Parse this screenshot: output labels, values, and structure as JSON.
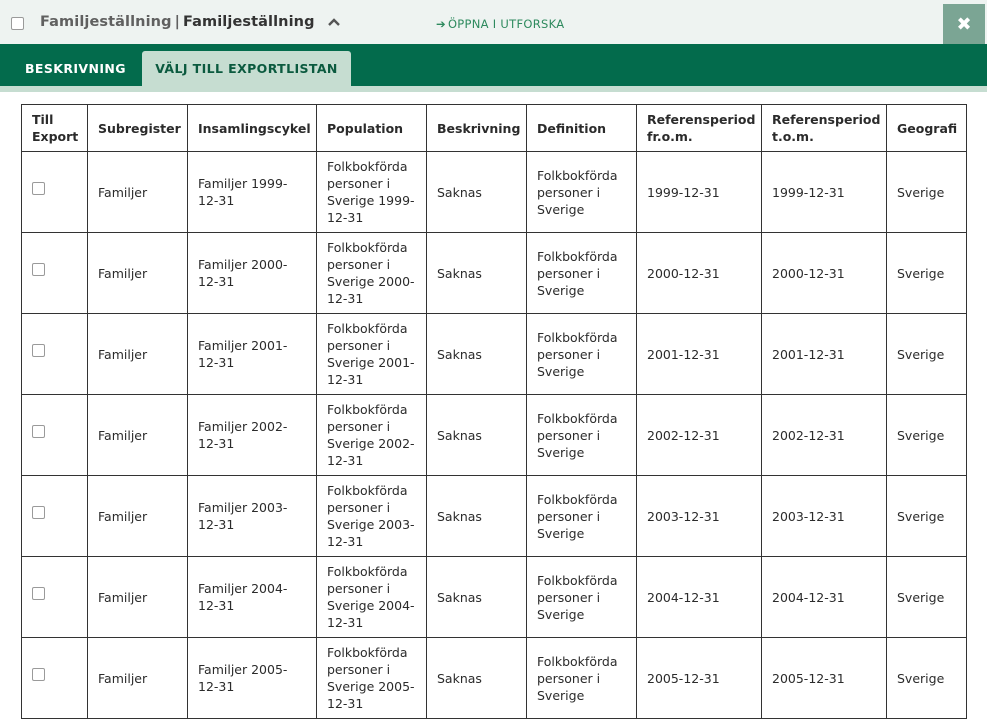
{
  "header": {
    "title_part1": "Familjeställning",
    "title_separator": "|",
    "title_part2": "Familjeställning",
    "explore_link": "ÖPPNA I UTFORSKA",
    "close_symbol": "✖"
  },
  "tabs": [
    {
      "label": "BESKRIVNING"
    },
    {
      "label": "VÄLJ TILL EXPORTLISTAN"
    }
  ],
  "table": {
    "columns": [
      "Till Export",
      "Subregister",
      "Insamlingscykel",
      "Population",
      "Beskrivning",
      "Definition",
      "Referensperiod fr.o.m.",
      "Referensperiod t.o.m.",
      "Geografi"
    ],
    "rows": [
      {
        "subregister": "Familjer",
        "cycle": "Familjer 1999-12-31",
        "population": "Folkbokförda personer i Sverige 1999-12-31",
        "description": "Saknas",
        "definition": "Folkbokförda personer i Sverige",
        "from": "1999-12-31",
        "to": "1999-12-31",
        "geo": "Sverige"
      },
      {
        "subregister": "Familjer",
        "cycle": "Familjer 2000-12-31",
        "population": "Folkbokförda personer i Sverige 2000-12-31",
        "description": "Saknas",
        "definition": "Folkbokförda personer i Sverige",
        "from": "2000-12-31",
        "to": "2000-12-31",
        "geo": "Sverige"
      },
      {
        "subregister": "Familjer",
        "cycle": "Familjer 2001-12-31",
        "population": "Folkbokförda personer i Sverige 2001-12-31",
        "description": "Saknas",
        "definition": "Folkbokförda personer i Sverige",
        "from": "2001-12-31",
        "to": "2001-12-31",
        "geo": "Sverige"
      },
      {
        "subregister": "Familjer",
        "cycle": "Familjer 2002-12-31",
        "population": "Folkbokförda personer i Sverige 2002-12-31",
        "description": "Saknas",
        "definition": "Folkbokförda personer i Sverige",
        "from": "2002-12-31",
        "to": "2002-12-31",
        "geo": "Sverige"
      },
      {
        "subregister": "Familjer",
        "cycle": "Familjer 2003-12-31",
        "population": "Folkbokförda personer i Sverige 2003-12-31",
        "description": "Saknas",
        "definition": "Folkbokförda personer i Sverige",
        "from": "2003-12-31",
        "to": "2003-12-31",
        "geo": "Sverige"
      },
      {
        "subregister": "Familjer",
        "cycle": "Familjer 2004-12-31",
        "population": "Folkbokförda personer i Sverige 2004-12-31",
        "description": "Saknas",
        "definition": "Folkbokförda personer i Sverige",
        "from": "2004-12-31",
        "to": "2004-12-31",
        "geo": "Sverige"
      },
      {
        "subregister": "Familjer",
        "cycle": "Familjer 2005-12-31",
        "population": "Folkbokförda personer i Sverige 2005-12-31",
        "description": "Saknas",
        "definition": "Folkbokförda personer i Sverige",
        "from": "2005-12-31",
        "to": "2005-12-31",
        "geo": "Sverige"
      }
    ]
  },
  "colors": {
    "tabbar": "#036b4c",
    "active_tab": "#c6ddd1",
    "close_button": "#7ba594",
    "link": "#2e8a5e"
  },
  "icons": [
    "checkbox-icon",
    "chevron-up-icon",
    "arrow-right-icon",
    "close-icon"
  ]
}
